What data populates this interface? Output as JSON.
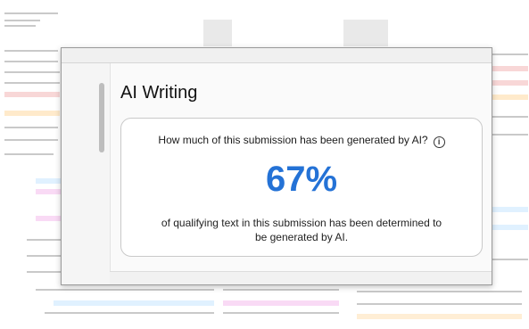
{
  "panel": {
    "title": "AI Writing"
  },
  "card": {
    "question": "How much of this submission has been generated by AI?",
    "info_icon": "i",
    "percent": "67%",
    "description": "of qualifying text in this submission has been determined to be generated by AI."
  },
  "colors": {
    "accent": "#2472d6"
  }
}
